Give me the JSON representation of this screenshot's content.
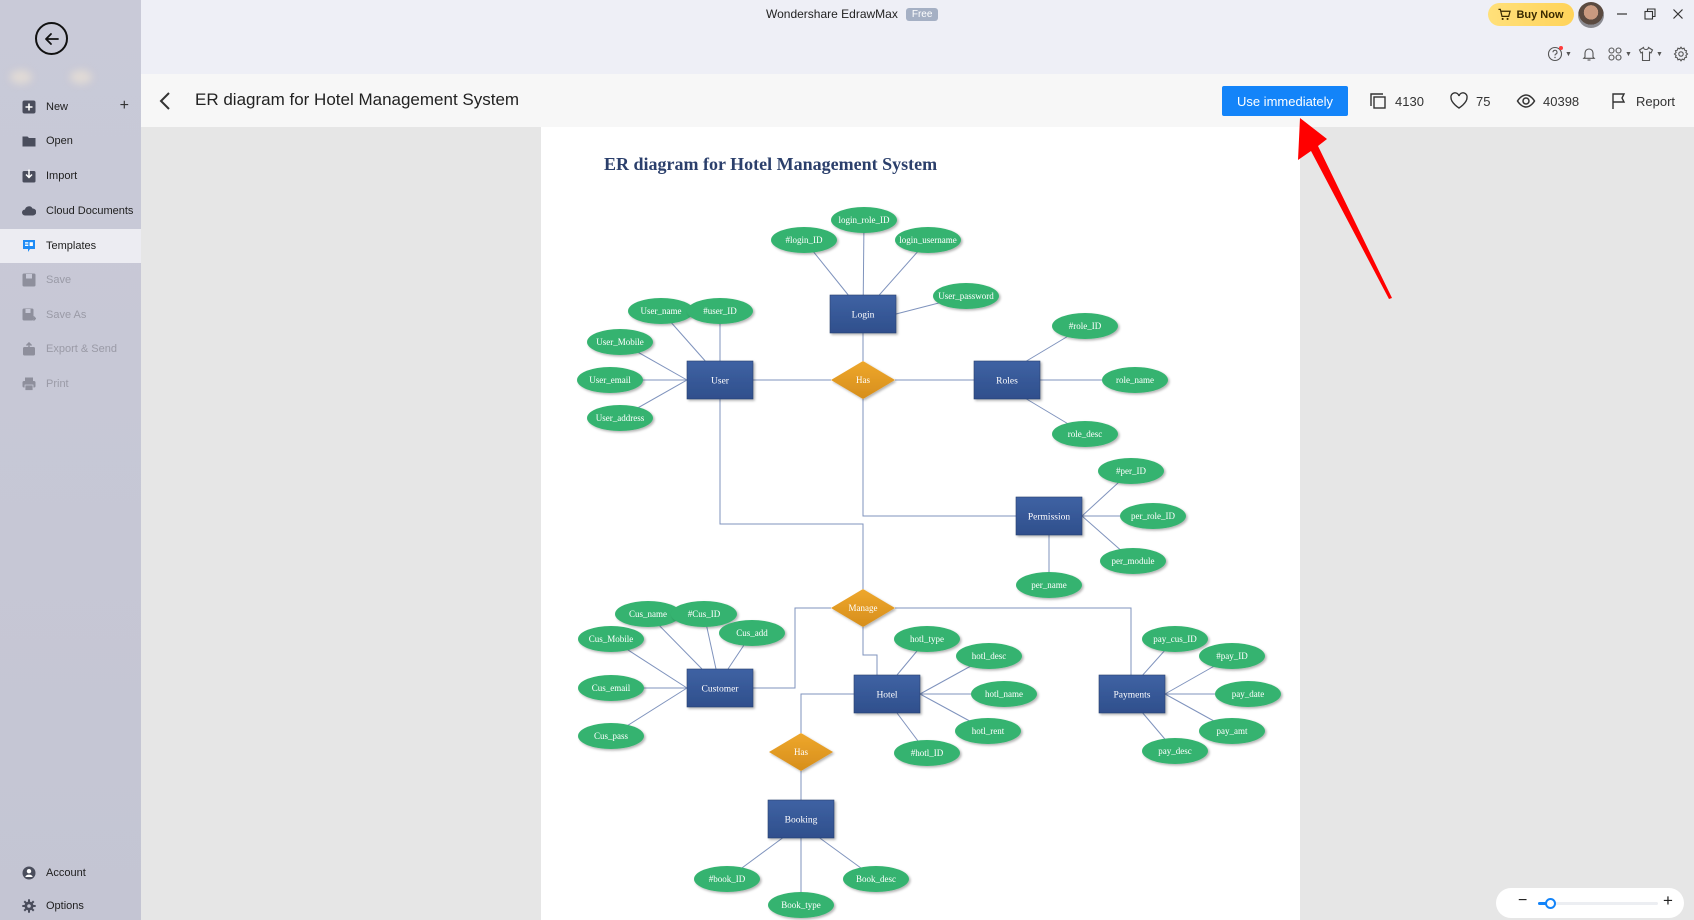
{
  "window": {
    "app_title": "Wondershare EdrawMax",
    "plan_badge": "Free",
    "buy_now_label": "Buy Now"
  },
  "toolbar_icons": [
    "help-icon",
    "bell-icon",
    "apps-icon",
    "theme-shirt-icon",
    "settings-gear-icon"
  ],
  "sidebar": {
    "items": [
      {
        "label": "New",
        "icon": "plus-square-icon",
        "state": "normal"
      },
      {
        "label": "Open",
        "icon": "folder-icon",
        "state": "normal"
      },
      {
        "label": "Import",
        "icon": "import-icon",
        "state": "normal"
      },
      {
        "label": "Cloud Documents",
        "icon": "cloud-icon",
        "state": "normal"
      },
      {
        "label": "Templates",
        "icon": "templates-icon",
        "state": "active"
      },
      {
        "label": "Save",
        "icon": "save-icon",
        "state": "disabled"
      },
      {
        "label": "Save As",
        "icon": "save-as-icon",
        "state": "disabled"
      },
      {
        "label": "Export & Send",
        "icon": "export-icon",
        "state": "disabled"
      },
      {
        "label": "Print",
        "icon": "print-icon",
        "state": "disabled"
      }
    ],
    "bottom": [
      {
        "label": "Account",
        "icon": "account-icon"
      },
      {
        "label": "Options",
        "icon": "options-gear-icon"
      }
    ]
  },
  "header": {
    "title": "ER diagram for Hotel Management System",
    "use_button": "Use immediately",
    "copies": "4130",
    "likes": "75",
    "views": "40398",
    "report_label": "Report"
  },
  "zoom": {
    "level_fraction": 0.1
  },
  "colors": {
    "accent": "#1384f9",
    "entity": "#3a5a98",
    "relationship": "#e19a25",
    "attribute": "#36b36f",
    "annotation_arrow": "#ff0000"
  },
  "diagram": {
    "title": "ER diagram for Hotel Management System",
    "entities": {
      "login": "Login",
      "user": "User",
      "roles": "Roles",
      "permission": "Permission",
      "customer": "Customer",
      "hotel": "Hotel",
      "payments": "Payments",
      "booking": "Booking"
    },
    "relationships": {
      "has1": "Has",
      "manage": "Manage",
      "has2": "Has"
    },
    "attributes": {
      "login_id": "#login_ID",
      "login_role_id": "login_role_ID",
      "login_username": "login_username",
      "user_password": "User_password",
      "user_name": "User_name",
      "user_id": "#user_ID",
      "user_mobile": "User_Mobile",
      "user_email": "User_email",
      "user_address": "User_address",
      "role_id": "#role_ID",
      "role_name": "role_name",
      "role_desc": "role_desc",
      "per_id": "#per_ID",
      "per_role_id": "per_role_ID",
      "per_module": "per_module",
      "per_name": "per_name",
      "cus_name": "Cus_name",
      "cus_id": "#Cus_ID",
      "cus_add": "Cus_add",
      "cus_mobile": "Cus_Mobile",
      "cus_email": "Cus_email",
      "cus_pass": "Cus_pass",
      "hotl_type": "hotl_type",
      "hotl_desc": "hotl_desc",
      "hotl_name": "hotl_name",
      "hotl_rent": "hotl_rent",
      "hotl_id": "#hotl_ID",
      "pay_cus_id": "pay_cus_ID",
      "pay_id": "#pay_ID",
      "pay_date": "pay_date",
      "pay_amt": "pay_amt",
      "pay_desc": "pay_desc",
      "book_id": "#book_ID",
      "book_type": "Book_type",
      "book_desc": "Book_desc"
    }
  }
}
